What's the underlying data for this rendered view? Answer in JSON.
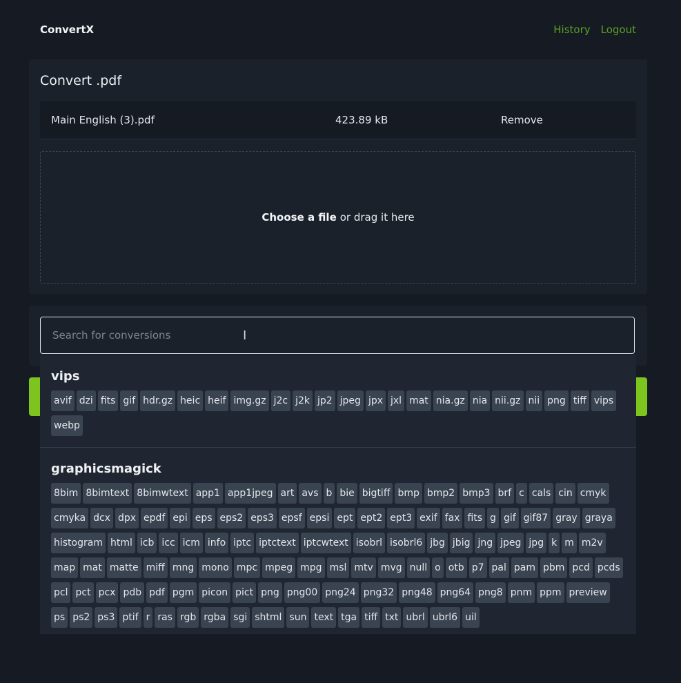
{
  "header": {
    "brand": "ConvertX",
    "nav": [
      "History",
      "Logout"
    ]
  },
  "upload": {
    "title": "Convert .pdf",
    "file": {
      "name": "Main English (3).pdf",
      "size": "423.89 kB",
      "remove_label": "Remove"
    },
    "dropzone": {
      "choose_label": "Choose a file",
      "drag_label": "or drag it here"
    }
  },
  "search": {
    "placeholder": "Search for conversions",
    "value": ""
  },
  "colors": {
    "accent": "#7dc41e",
    "link": "#5aa222",
    "background": "#151a23"
  },
  "groups": [
    {
      "name": "vips",
      "formats": [
        "avif",
        "dzi",
        "fits",
        "gif",
        "hdr.gz",
        "heic",
        "heif",
        "img.gz",
        "j2c",
        "j2k",
        "jp2",
        "jpeg",
        "jpx",
        "jxl",
        "mat",
        "nia.gz",
        "nia",
        "nii.gz",
        "nii",
        "png",
        "tiff",
        "vips",
        "webp"
      ]
    },
    {
      "name": "graphicsmagick",
      "formats": [
        "8bim",
        "8bimtext",
        "8bimwtext",
        "app1",
        "app1jpeg",
        "art",
        "avs",
        "b",
        "bie",
        "bigtiff",
        "bmp",
        "bmp2",
        "bmp3",
        "brf",
        "c",
        "cals",
        "cin",
        "cmyk",
        "cmyka",
        "dcx",
        "dpx",
        "epdf",
        "epi",
        "eps",
        "eps2",
        "eps3",
        "epsf",
        "epsi",
        "ept",
        "ept2",
        "ept3",
        "exif",
        "fax",
        "fits",
        "g",
        "gif",
        "gif87",
        "gray",
        "graya",
        "histogram",
        "html",
        "icb",
        "icc",
        "icm",
        "info",
        "iptc",
        "iptctext",
        "iptcwtext",
        "isobrl",
        "isobrl6",
        "jbg",
        "jbig",
        "jng",
        "jpeg",
        "jpg",
        "k",
        "m",
        "m2v",
        "map",
        "mat",
        "matte",
        "miff",
        "mng",
        "mono",
        "mpc",
        "mpeg",
        "mpg",
        "msl",
        "mtv",
        "mvg",
        "null",
        "o",
        "otb",
        "p7",
        "pal",
        "pam",
        "pbm",
        "pcd",
        "pcds",
        "pcl",
        "pct",
        "pcx",
        "pdb",
        "pdf",
        "pgm",
        "picon",
        "pict",
        "png",
        "png00",
        "png24",
        "png32",
        "png48",
        "png64",
        "png8",
        "pnm",
        "ppm",
        "preview",
        "ps",
        "ps2",
        "ps3",
        "ptif",
        "r",
        "ras",
        "rgb",
        "rgba",
        "sgi",
        "shtml",
        "sun",
        "text",
        "tga",
        "tiff",
        "txt",
        "ubrl",
        "ubrl6",
        "uil"
      ]
    }
  ]
}
